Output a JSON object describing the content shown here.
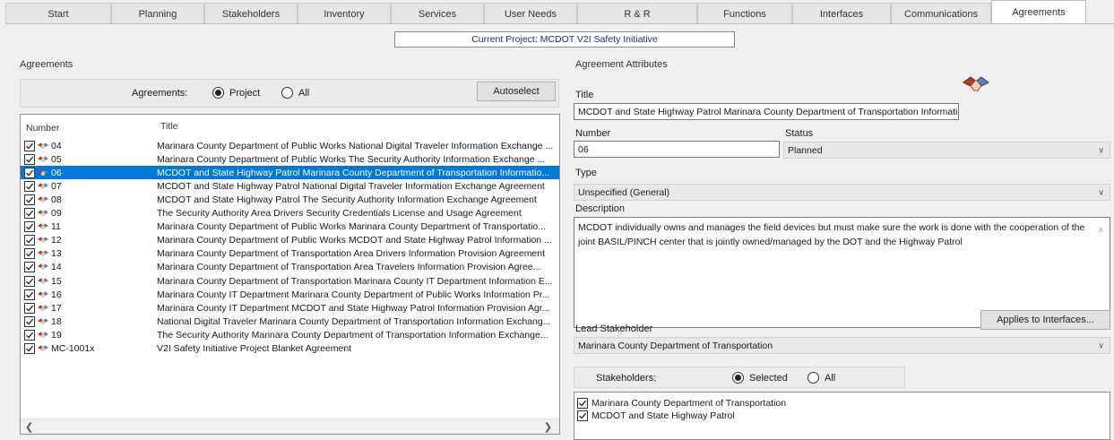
{
  "tabs": [
    {
      "label": "Start",
      "active": false
    },
    {
      "label": "Planning",
      "active": false
    },
    {
      "label": "Stakeholders",
      "active": false
    },
    {
      "label": "Inventory",
      "active": false
    },
    {
      "label": "Services",
      "active": false
    },
    {
      "label": "User Needs",
      "active": false
    },
    {
      "label": "R & R",
      "active": false
    },
    {
      "label": "Functions",
      "active": false
    },
    {
      "label": "Interfaces",
      "active": false
    },
    {
      "label": "Communications",
      "active": false
    },
    {
      "label": "Agreements",
      "active": true
    }
  ],
  "project_banner": "Current Project: MCDOT V2I Safety Initiative",
  "agreements_panel": {
    "group_title": "Agreements",
    "filter_label": "Agreements:",
    "radio_project": "Project",
    "radio_all": "All",
    "selected_filter": "Project",
    "autoselect_label": "Autoselect",
    "col_number": "Number",
    "col_title": "Title",
    "rows": [
      {
        "number": "04",
        "title": "Marinara County Department of Public Works National Digital Traveler Information Exchange ...",
        "checked": true,
        "selected": false
      },
      {
        "number": "05",
        "title": "Marinara County Department of Public Works The Security Authority Information Exchange ...",
        "checked": true,
        "selected": false
      },
      {
        "number": "06",
        "title": "MCDOT and State Highway Patrol Marinara County Department of Transportation Informatio...",
        "checked": true,
        "selected": true
      },
      {
        "number": "07",
        "title": "MCDOT and State Highway Patrol National Digital Traveler Information Exchange Agreement",
        "checked": true,
        "selected": false
      },
      {
        "number": "08",
        "title": "MCDOT and State Highway Patrol The Security Authority Information Exchange Agreement",
        "checked": true,
        "selected": false
      },
      {
        "number": "09",
        "title": "The Security Authority Area Drivers Security Credentials License and Usage Agreement",
        "checked": true,
        "selected": false
      },
      {
        "number": "11",
        "title": "Marinara County Department of Public Works Marinara County Department of Transportatio...",
        "checked": true,
        "selected": false
      },
      {
        "number": "12",
        "title": "Marinara County Department of Public Works MCDOT and State Highway Patrol Information ...",
        "checked": true,
        "selected": false
      },
      {
        "number": "13",
        "title": "Marinara County Department of Transportation Area Drivers Information Provision Agreement",
        "checked": true,
        "selected": false
      },
      {
        "number": "14",
        "title": "Marinara County Department of Transportation Area Travelers Information Provision Agree...",
        "checked": true,
        "selected": false
      },
      {
        "number": "15",
        "title": "Marinara County Department of Transportation Marinara County IT Department Information E...",
        "checked": true,
        "selected": false
      },
      {
        "number": "16",
        "title": "Marinara County IT Department Marinara County Department of Public Works Information Pr...",
        "checked": true,
        "selected": false
      },
      {
        "number": "17",
        "title": "Marinara County IT Department MCDOT and State Highway Patrol Information Provision Agr...",
        "checked": true,
        "selected": false
      },
      {
        "number": "18",
        "title": "National Digital Traveler Marinara County Department of Transportation Information Exchang...",
        "checked": true,
        "selected": false
      },
      {
        "number": "19",
        "title": "The Security Authority Marinara County Department of Transportation Information Exchange...",
        "checked": true,
        "selected": false
      },
      {
        "number": "MC-1001x",
        "title": "V2I Safety Initiative Project Blanket Agreement",
        "checked": true,
        "selected": false
      }
    ]
  },
  "attributes_panel": {
    "group_title": "Agreement Attributes",
    "title_label": "Title",
    "title_value": "MCDOT and State Highway Patrol Marinara County Department of Transportation Informati",
    "number_label": "Number",
    "number_value": "06",
    "status_label": "Status",
    "status_value": "Planned",
    "type_label": "Type",
    "type_value": "Unspecified (General)",
    "description_label": "Description",
    "description_value": "MCDOT individually owns and manages the field devices but must make sure the work is done with the cooperation of the joint BASIL/PINCH center that is jointly owned/managed by the DOT and the Highway Patrol",
    "applies_button": "Applies to Interfaces...",
    "lead_label": "Lead Stakeholder",
    "lead_value": "Marinara County Department of Transportation",
    "stakeholders_label": "Stakeholders:",
    "radio_selected": "Selected",
    "radio_all": "All",
    "selected_filter": "Selected",
    "stakeholders": [
      {
        "name": "Marinara County Department of Transportation",
        "checked": true
      },
      {
        "name": "MCDOT and State Highway Patrol",
        "checked": true
      }
    ]
  },
  "icons": {
    "agreement": "handshake-icon",
    "row_icon": "agreement-handshake-icon",
    "check": "checkmark-icon"
  },
  "colors": {
    "selection": "#0078d7",
    "banner_text": "#1f2d8a"
  }
}
